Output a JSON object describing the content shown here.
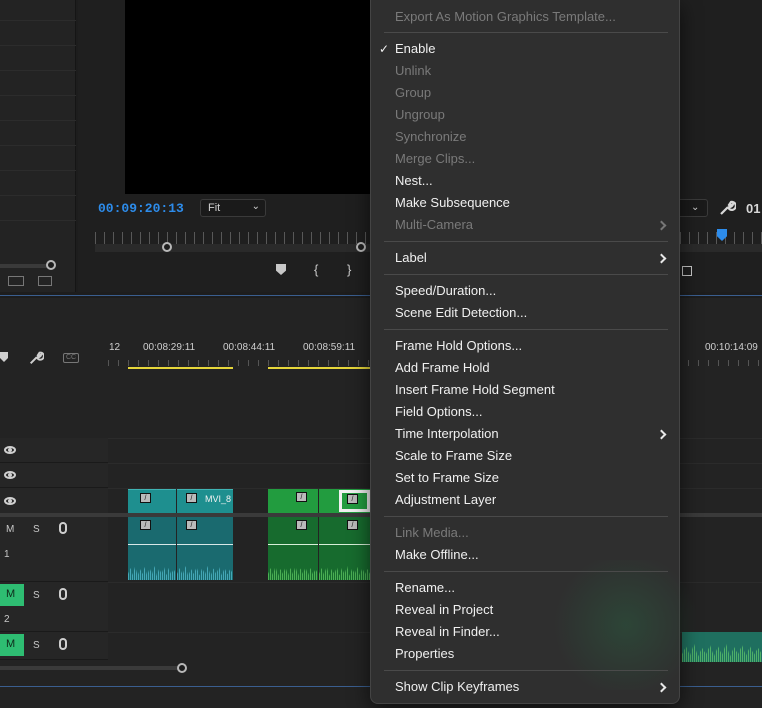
{
  "monitor": {
    "timecode": "00:09:20:13",
    "fit_label": "Fit",
    "fit_right": "",
    "timecode_right": "01",
    "buttons": [
      "marker",
      "in",
      "out"
    ]
  },
  "timeline": {
    "ruler_labels": [
      "12",
      "00:08:29:11",
      "00:08:44:11",
      "00:08:59:11",
      "00:10:14:09"
    ],
    "tracks": [
      {
        "m": "M",
        "s": "S",
        "num": "1"
      },
      {
        "m": "M",
        "s": "S",
        "num": "2"
      },
      {
        "m": "M",
        "s": "S",
        "num": ""
      }
    ],
    "clip_name": "MVI_8"
  },
  "menu": {
    "items": [
      {
        "label": "Export As Motion Graphics Template...",
        "disabled": true,
        "checked": false,
        "submenu": false
      },
      {
        "label": "Enable",
        "disabled": false,
        "checked": true,
        "submenu": false
      },
      {
        "label": "Unlink",
        "disabled": true,
        "checked": false,
        "submenu": false
      },
      {
        "label": "Group",
        "disabled": true,
        "checked": false,
        "submenu": false
      },
      {
        "label": "Ungroup",
        "disabled": true,
        "checked": false,
        "submenu": false
      },
      {
        "label": "Synchronize",
        "disabled": true,
        "checked": false,
        "submenu": false
      },
      {
        "label": "Merge Clips...",
        "disabled": true,
        "checked": false,
        "submenu": false
      },
      {
        "label": "Nest...",
        "disabled": false,
        "checked": false,
        "submenu": false
      },
      {
        "label": "Make Subsequence",
        "disabled": false,
        "checked": false,
        "submenu": false
      },
      {
        "label": "Multi-Camera",
        "disabled": true,
        "checked": false,
        "submenu": true
      },
      {
        "label": "Label",
        "disabled": false,
        "checked": false,
        "submenu": true
      },
      {
        "label": "Speed/Duration...",
        "disabled": false,
        "checked": false,
        "submenu": false
      },
      {
        "label": "Scene Edit Detection...",
        "disabled": false,
        "checked": false,
        "submenu": false
      },
      {
        "label": "Frame Hold Options...",
        "disabled": false,
        "checked": false,
        "submenu": false
      },
      {
        "label": "Add Frame Hold",
        "disabled": false,
        "checked": false,
        "submenu": false
      },
      {
        "label": "Insert Frame Hold Segment",
        "disabled": false,
        "checked": false,
        "submenu": false
      },
      {
        "label": "Field Options...",
        "disabled": false,
        "checked": false,
        "submenu": false
      },
      {
        "label": "Time Interpolation",
        "disabled": false,
        "checked": false,
        "submenu": true
      },
      {
        "label": "Scale to Frame Size",
        "disabled": false,
        "checked": false,
        "submenu": false
      },
      {
        "label": "Set to Frame Size",
        "disabled": false,
        "checked": false,
        "submenu": false
      },
      {
        "label": "Adjustment Layer",
        "disabled": false,
        "checked": false,
        "submenu": false
      },
      {
        "label": "Link Media...",
        "disabled": true,
        "checked": false,
        "submenu": false
      },
      {
        "label": "Make Offline...",
        "disabled": false,
        "checked": false,
        "submenu": false
      },
      {
        "label": "Rename...",
        "disabled": false,
        "checked": false,
        "submenu": false
      },
      {
        "label": "Reveal in Project",
        "disabled": false,
        "checked": false,
        "submenu": false
      },
      {
        "label": "Reveal in Finder...",
        "disabled": false,
        "checked": false,
        "submenu": false
      },
      {
        "label": "Properties",
        "disabled": false,
        "checked": false,
        "submenu": false
      },
      {
        "label": "Show Clip Keyframes",
        "disabled": false,
        "checked": false,
        "submenu": true
      }
    ]
  },
  "colors": {
    "accent_blue": "#2d8ceb",
    "audio_green": "#2ebd72",
    "menu_bg": "#2f2f2f"
  }
}
